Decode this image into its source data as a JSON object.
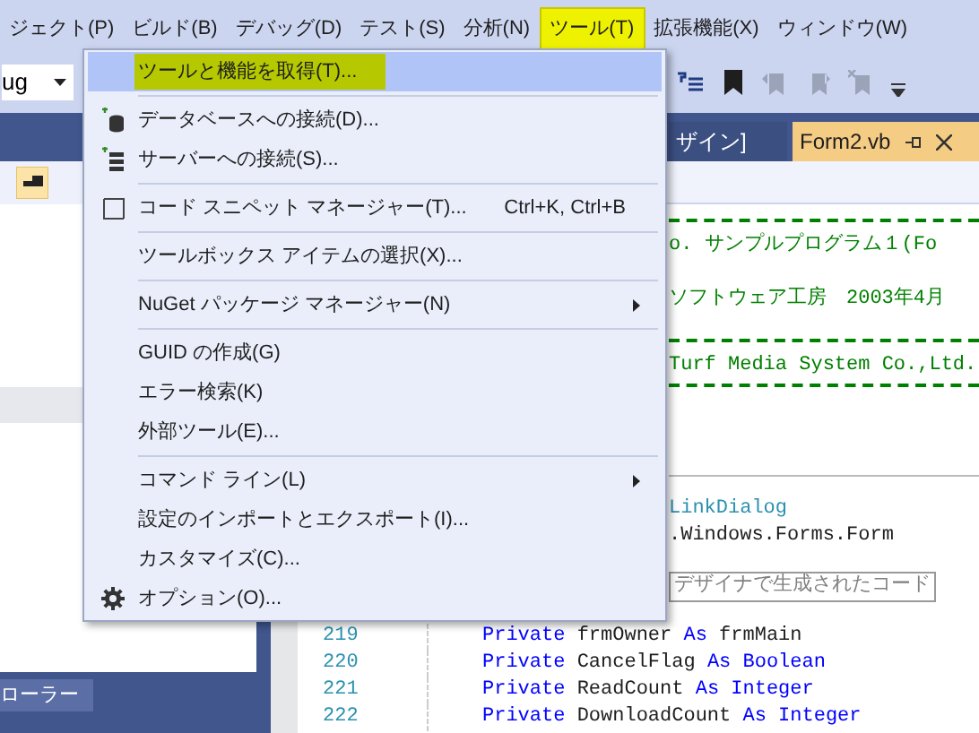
{
  "menu_bar": {
    "items": [
      {
        "label": "ジェクト(P)",
        "selected": false
      },
      {
        "label": "ビルド(B)",
        "selected": false
      },
      {
        "label": "デバッグ(D)",
        "selected": false
      },
      {
        "label": "テスト(S)",
        "selected": false
      },
      {
        "label": "分析(N)",
        "selected": false
      },
      {
        "label": "ツール(T)",
        "selected": true
      },
      {
        "label": "拡張機能(X)",
        "selected": false
      },
      {
        "label": "ウィンドウ(W)",
        "selected": false
      }
    ]
  },
  "toolbar": {
    "config_combo": "ug"
  },
  "tools_menu": {
    "groups": [
      [
        {
          "label": "ツールと機能を取得(T)...",
          "selected": true,
          "has_submenu": false
        }
      ],
      [
        {
          "label": "データベースへの接続(D)...",
          "selected": false,
          "has_submenu": false
        },
        {
          "label": "サーバーへの接続(S)...",
          "selected": false,
          "has_submenu": false
        }
      ],
      [
        {
          "label": "コード スニペット マネージャー(T)...",
          "shortcut": "Ctrl+K, Ctrl+B",
          "selected": false,
          "has_submenu": false
        }
      ],
      [
        {
          "label": "ツールボックス アイテムの選択(X)...",
          "selected": false,
          "has_submenu": false
        }
      ],
      [
        {
          "label": "NuGet パッケージ マネージャー(N)",
          "selected": false,
          "has_submenu": true
        }
      ],
      [
        {
          "label": "GUID の作成(G)",
          "selected": false,
          "has_submenu": false
        },
        {
          "label": "エラー検索(K)",
          "selected": false,
          "has_submenu": false
        },
        {
          "label": "外部ツール(E)...",
          "selected": false,
          "has_submenu": false
        }
      ],
      [
        {
          "label": "コマンド ライン(L)",
          "selected": false,
          "has_submenu": true
        },
        {
          "label": "設定のインポートとエクスポート(I)...",
          "selected": false,
          "has_submenu": false
        },
        {
          "label": "カスタマイズ(C)...",
          "selected": false,
          "has_submenu": false
        },
        {
          "label": "オプション(O)...",
          "selected": false,
          "has_submenu": false
        }
      ]
    ]
  },
  "left_panel": {
    "bottom_tab": "ローラー"
  },
  "editor": {
    "tabs": [
      {
        "label": "ザイン]",
        "selected": false
      },
      {
        "label": "Form2.vb",
        "selected": true
      }
    ],
    "header_lines": [
      "o. サンプルプログラム１(Fo",
      "ソフトウェア工房　2003年4月",
      "Turf Media System Co.,Ltd."
    ],
    "decl_lines": [
      {
        "text": "LinkDialog",
        "kind": "type"
      },
      {
        "text": ".Windows.Forms.Form",
        "kind": "plain"
      }
    ],
    "region_label": "デザイナで生成されたコード",
    "code_lines": [
      {
        "number": "219",
        "tokens": [
          {
            "text": "Private",
            "kind": "keyword"
          },
          {
            "text": " frmOwner ",
            "kind": "plain"
          },
          {
            "text": "As",
            "kind": "keyword"
          },
          {
            "text": " frmMain",
            "kind": "plain"
          }
        ]
      },
      {
        "number": "220",
        "tokens": [
          {
            "text": "Private",
            "kind": "keyword"
          },
          {
            "text": " CancelFlag ",
            "kind": "plain"
          },
          {
            "text": "As",
            "kind": "keyword"
          },
          {
            "text": " Boolean",
            "kind": "keyword"
          }
        ]
      },
      {
        "number": "221",
        "tokens": [
          {
            "text": "Private",
            "kind": "keyword"
          },
          {
            "text": " ReadCount ",
            "kind": "plain"
          },
          {
            "text": "As",
            "kind": "keyword"
          },
          {
            "text": " Integer",
            "kind": "keyword"
          }
        ]
      },
      {
        "number": "222",
        "tokens": [
          {
            "text": "Private",
            "kind": "keyword"
          },
          {
            "text": " DownloadCount ",
            "kind": "plain"
          },
          {
            "text": "As",
            "kind": "keyword"
          },
          {
            "text": " Integer",
            "kind": "keyword"
          }
        ]
      }
    ]
  }
}
